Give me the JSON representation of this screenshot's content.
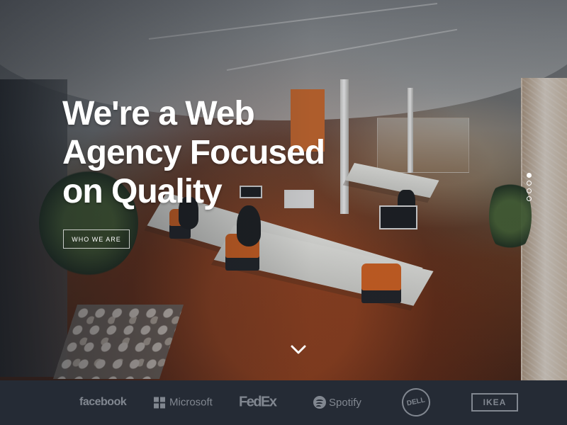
{
  "hero": {
    "title": "We're a Web\nAgency Focused\non Quality",
    "cta_label": "WHO WE ARE",
    "scroll_icon": "chevron-down-icon",
    "slider_dots": [
      {
        "active": true
      },
      {
        "active": false
      },
      {
        "active": false
      },
      {
        "active": false
      }
    ],
    "photo": "open-plan office with desks, computers, orange chairs, plants and wooden floor"
  },
  "client_logos": {
    "facebook": "facebook",
    "microsoft": "Microsoft",
    "fedex": "FedEx",
    "spotify": "Spotify",
    "dell": "DELL",
    "ikea": "IKEA"
  },
  "colors": {
    "hero_text": "#ffffff",
    "logo_bar": "#252b35",
    "logo_text": "#8b919a"
  }
}
